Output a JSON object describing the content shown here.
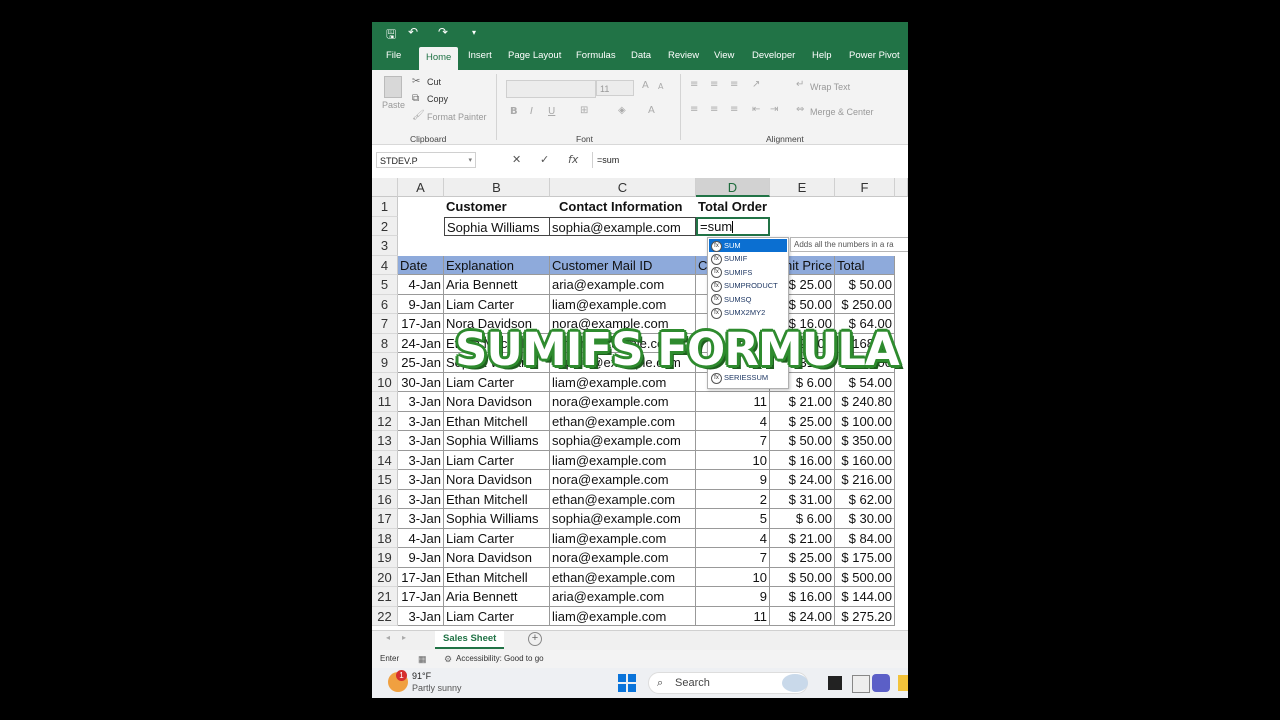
{
  "quick_access": {
    "save": "🖫",
    "undo": "↶",
    "redo": "↷",
    "more": "▾"
  },
  "tabs": [
    "File",
    "Home",
    "Insert",
    "Page Layout",
    "Formulas",
    "Data",
    "Review",
    "View",
    "Developer",
    "Help",
    "Power Pivot"
  ],
  "ribbon": {
    "clipboard": {
      "paste": "Paste",
      "cut": "Cut",
      "copy": "Copy",
      "format_painter": "Format Painter",
      "group": "Clipboard"
    },
    "font": {
      "size": "11",
      "bold": "B",
      "italic": "I",
      "underline": "U",
      "group": "Font"
    },
    "alignment": {
      "wrap_text": "Wrap Text",
      "merge_center": "Merge & Center",
      "group": "Alignment"
    }
  },
  "formula_bar": {
    "name_box": "STDEV.P",
    "cancel": "✕",
    "enter": "✓",
    "fx": "fx",
    "content": "=sum"
  },
  "columns": [
    "A",
    "B",
    "C",
    "D",
    "E",
    "F"
  ],
  "header_row": {
    "customer": "Customer",
    "contact": "Contact Information",
    "total": "Total Order"
  },
  "row2": {
    "name": "Sophia Williams",
    "email": "sophia@example.com",
    "edit": "=sum"
  },
  "table_headers": [
    "Date",
    "Explanation",
    "Customer Mail ID",
    "C",
    "Unit Price",
    "Total"
  ],
  "rows": [
    {
      "n": "5",
      "date": "4-Jan",
      "name": "Aria Bennett",
      "email": "aria@example.com",
      "qty": "",
      "price": "$ 25.00",
      "total": "$ 50.00"
    },
    {
      "n": "6",
      "date": "9-Jan",
      "name": "Liam Carter",
      "email": "liam@example.com",
      "qty": "",
      "price": "$ 50.00",
      "total": "$ 250.00"
    },
    {
      "n": "7",
      "date": "17-Jan",
      "name": "Nora Davidson",
      "email": "nora@example.com",
      "qty": "",
      "price": "$ 16.00",
      "total": "$ 64.00"
    },
    {
      "n": "8",
      "date": "24-Jan",
      "name": "Ethan Mitchell",
      "email": "ethan@example.com",
      "qty": "",
      "price": "$ 24.00",
      "total": "$ 168.00"
    },
    {
      "n": "9",
      "date": "25-Jan",
      "name": "Sophia Williams",
      "email": "sophia@example.com",
      "qty": "",
      "price": "$ 31.00",
      "total": "$ 310.00"
    },
    {
      "n": "10",
      "date": "30-Jan",
      "name": "Liam Carter",
      "email": "liam@example.com",
      "qty": "",
      "price": "$ 6.00",
      "total": "$ 54.00"
    },
    {
      "n": "11",
      "date": "3-Jan",
      "name": "Nora Davidson",
      "email": "nora@example.com",
      "qty": "11",
      "price": "$ 21.00",
      "total": "$ 240.80"
    },
    {
      "n": "12",
      "date": "3-Jan",
      "name": "Ethan Mitchell",
      "email": "ethan@example.com",
      "qty": "4",
      "price": "$ 25.00",
      "total": "$ 100.00"
    },
    {
      "n": "13",
      "date": "3-Jan",
      "name": "Sophia Williams",
      "email": "sophia@example.com",
      "qty": "7",
      "price": "$ 50.00",
      "total": "$ 350.00"
    },
    {
      "n": "14",
      "date": "3-Jan",
      "name": "Liam Carter",
      "email": "liam@example.com",
      "qty": "10",
      "price": "$ 16.00",
      "total": "$ 160.00"
    },
    {
      "n": "15",
      "date": "3-Jan",
      "name": "Nora Davidson",
      "email": "nora@example.com",
      "qty": "9",
      "price": "$ 24.00",
      "total": "$ 216.00"
    },
    {
      "n": "16",
      "date": "3-Jan",
      "name": "Ethan Mitchell",
      "email": "ethan@example.com",
      "qty": "2",
      "price": "$ 31.00",
      "total": "$ 62.00"
    },
    {
      "n": "17",
      "date": "3-Jan",
      "name": "Sophia Williams",
      "email": "sophia@example.com",
      "qty": "5",
      "price": "$ 6.00",
      "total": "$ 30.00"
    },
    {
      "n": "18",
      "date": "4-Jan",
      "name": "Liam Carter",
      "email": "liam@example.com",
      "qty": "4",
      "price": "$ 21.00",
      "total": "$ 84.00"
    },
    {
      "n": "19",
      "date": "9-Jan",
      "name": "Nora Davidson",
      "email": "nora@example.com",
      "qty": "7",
      "price": "$ 25.00",
      "total": "$ 175.00"
    },
    {
      "n": "20",
      "date": "17-Jan",
      "name": "Ethan Mitchell",
      "email": "ethan@example.com",
      "qty": "10",
      "price": "$ 50.00",
      "total": "$ 500.00"
    },
    {
      "n": "21",
      "date": "17-Jan",
      "name": "Aria Bennett",
      "email": "aria@example.com",
      "qty": "9",
      "price": "$ 16.00",
      "total": "$ 144.00"
    },
    {
      "n": "22",
      "date": "3-Jan",
      "name": "Liam Carter",
      "email": "liam@example.com",
      "qty": "11",
      "price": "$ 24.00",
      "total": "$ 275.20"
    }
  ],
  "autocomplete": {
    "items": [
      "SUM",
      "SUMIF",
      "SUMIFS",
      "SUMPRODUCT",
      "SUMSQ",
      "SUMX2MY2",
      "SERIESSUM"
    ],
    "tooltip": "Adds all the numbers in a ra"
  },
  "overlay_text": "SUMIFS FORMULA",
  "sheet_tab": "Sales Sheet",
  "status": {
    "mode": "Enter",
    "accessibility": "Accessibility: Good to go"
  },
  "taskbar": {
    "temp": "91°F",
    "weather": "Partly sunny",
    "search": "Search",
    "badge": "1"
  },
  "colors": {
    "excel_green": "#217346",
    "header_fill": "#8eaadb",
    "overlay_outline": "#2e8b2e"
  }
}
